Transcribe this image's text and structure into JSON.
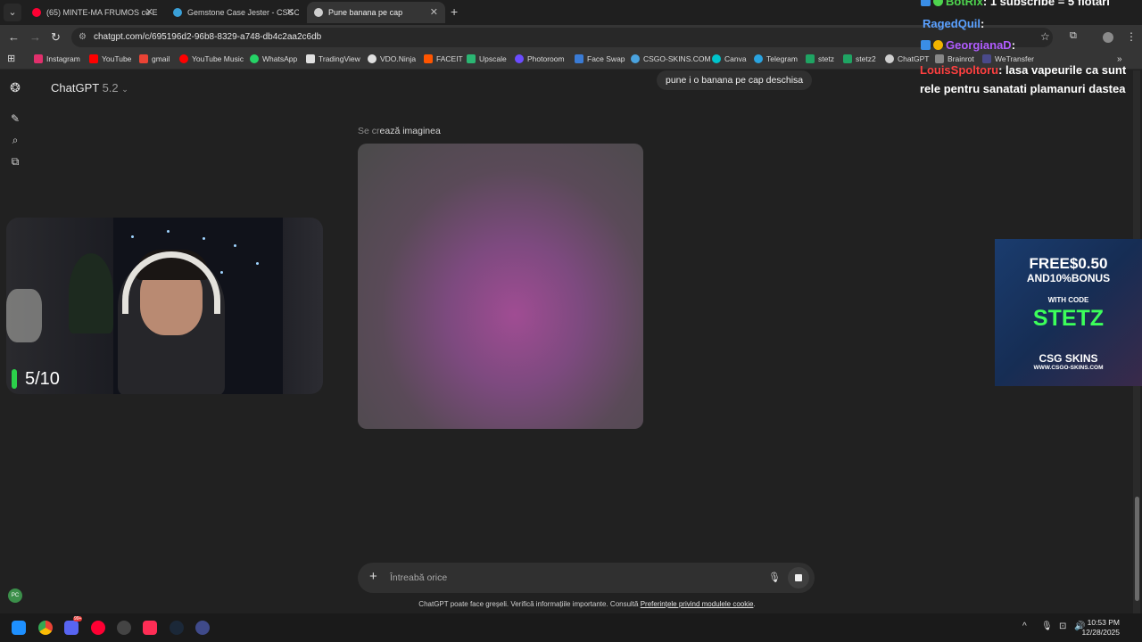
{
  "browser": {
    "tabs": [
      {
        "title": "(65) MINTE-MA FRUMOS cu Em",
        "active": false,
        "favicon_color": "#ff0033"
      },
      {
        "title": "Gemstone Case Jester - CSGO-",
        "active": false,
        "favicon_color": "#3aa0d8"
      },
      {
        "title": "Pune banana pe cap",
        "active": true,
        "favicon_color": "#cfcfcf"
      }
    ],
    "url": "chatgpt.com/c/695196d2-96b8-8329-a748-db4c2aa2c6db",
    "bookmarks": [
      {
        "label": "Instagram",
        "color": "#e1306c"
      },
      {
        "label": "YouTube",
        "color": "#ff0000"
      },
      {
        "label": "gmail",
        "color": "#ea4335"
      },
      {
        "label": "YouTube Music",
        "color": "#ff0000"
      },
      {
        "label": "WhatsApp",
        "color": "#25d366"
      },
      {
        "label": "TradingView",
        "color": "#e0e0e0"
      },
      {
        "label": "VDO.Ninja",
        "color": "#e0e0e0"
      },
      {
        "label": "FACEIT",
        "color": "#ff5500"
      },
      {
        "label": "Upscale",
        "color": "#2bb673"
      },
      {
        "label": "Photoroom",
        "color": "#6b4cff"
      },
      {
        "label": "Face Swap",
        "color": "#3a7bd5"
      },
      {
        "label": "CSGO-SKINS.COM",
        "color": "#4aa3df"
      },
      {
        "label": "Canva",
        "color": "#00c4cc"
      },
      {
        "label": "Telegram",
        "color": "#2aa3df"
      },
      {
        "label": "stetz",
        "color": "#1fa463"
      },
      {
        "label": "stetz2",
        "color": "#1fa463"
      },
      {
        "label": "ChatGPT",
        "color": "#cfcfcf"
      },
      {
        "label": "Brainrot",
        "color": "#888888"
      },
      {
        "label": "WeTransfer",
        "color": "#4a4a8a"
      }
    ]
  },
  "chatgpt": {
    "model_name": "ChatGPT",
    "model_version": "5.2",
    "user_message": "pune i o banana pe cap deschisa",
    "status_prefix": "Se cr",
    "status_rest": "ează imaginea",
    "composer_placeholder": "Întreabă orice",
    "disclaimer_text": "ChatGPT poate face greșeli. Verifică informațiile importante. Consultă ",
    "disclaimer_link": "Preferințele privind modulele cookie",
    "disclaimer_end": ".",
    "avatar_initials": "PC"
  },
  "stream_overlay": {
    "score": "5/10",
    "chat": [
      {
        "name": "BotRix",
        "message": ": 1 subscribe = 5 flotari",
        "name_color": "#4ed44e"
      },
      {
        "name": "RagedQuil",
        "message": ":",
        "name_color": "#5aa0ff"
      },
      {
        "name": "GeorgianaD",
        "message": ":",
        "name_color": "#b15cff"
      },
      {
        "name": "LouisSpoltoru",
        "message": ": lasa vapeurile ca sunt rele pentru sanatati plamanuri dastea",
        "name_color": "#ff4040"
      }
    ],
    "ad": {
      "line1": "FREE$0.50",
      "line2": "AND10%BONUS",
      "line3": "WITH CODE",
      "code": "STETZ",
      "brand": "CSG SKINS",
      "site": "WWW.CSGO-SKINS.COM"
    }
  },
  "taskbar": {
    "time": "10:53 PM",
    "date": "12/28/2025",
    "discord_badge": "99+"
  }
}
